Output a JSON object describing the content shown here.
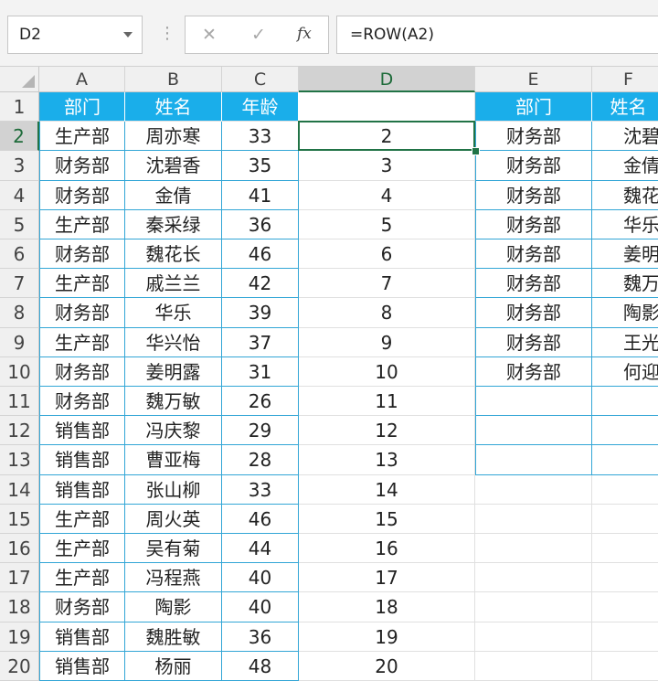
{
  "name_box": "D2",
  "formula": "=ROW(A2)",
  "formula_bar_separator": "⋮",
  "formula_bar_icons": [
    "cancel-icon",
    "enter-icon",
    "insert-function-icon"
  ],
  "columns": [
    "A",
    "B",
    "C",
    "D",
    "E",
    "F"
  ],
  "selected_cell": "D2",
  "header_color": "#1aaeea",
  "table_left": {
    "headers": [
      "部门",
      "姓名",
      "年龄"
    ],
    "rows": [
      [
        "生产部",
        "周亦寒",
        "33"
      ],
      [
        "财务部",
        "沈碧香",
        "35"
      ],
      [
        "财务部",
        "金倩",
        "41"
      ],
      [
        "生产部",
        "秦采绿",
        "36"
      ],
      [
        "财务部",
        "魏花长",
        "46"
      ],
      [
        "生产部",
        "戚兰兰",
        "42"
      ],
      [
        "财务部",
        "华乐",
        "39"
      ],
      [
        "生产部",
        "华兴怡",
        "37"
      ],
      [
        "财务部",
        "姜明露",
        "31"
      ],
      [
        "财务部",
        "魏万敏",
        "26"
      ],
      [
        "销售部",
        "冯庆黎",
        "29"
      ],
      [
        "销售部",
        "曹亚梅",
        "28"
      ],
      [
        "销售部",
        "张山柳",
        "33"
      ],
      [
        "生产部",
        "周火英",
        "46"
      ],
      [
        "生产部",
        "吴有菊",
        "44"
      ],
      [
        "生产部",
        "冯程燕",
        "40"
      ],
      [
        "财务部",
        "陶影",
        "40"
      ],
      [
        "销售部",
        "魏胜敏",
        "36"
      ],
      [
        "销售部",
        "杨丽",
        "48"
      ]
    ]
  },
  "column_d": [
    "",
    "2",
    "3",
    "4",
    "5",
    "6",
    "7",
    "8",
    "9",
    "10",
    "11",
    "12",
    "13",
    "14",
    "15",
    "16",
    "17",
    "18",
    "19",
    "20"
  ],
  "table_right": {
    "headers": [
      "部门",
      "姓名"
    ],
    "rows": [
      [
        "财务部",
        "沈碧香"
      ],
      [
        "财务部",
        "金倩"
      ],
      [
        "财务部",
        "魏花长"
      ],
      [
        "财务部",
        "华乐"
      ],
      [
        "财务部",
        "姜明露"
      ],
      [
        "财务部",
        "魏万敏"
      ],
      [
        "财务部",
        "陶影"
      ],
      [
        "财务部",
        "王光"
      ],
      [
        "财务部",
        "何迎"
      ],
      [
        "",
        ""
      ],
      [
        "",
        ""
      ],
      [
        "",
        ""
      ]
    ]
  }
}
